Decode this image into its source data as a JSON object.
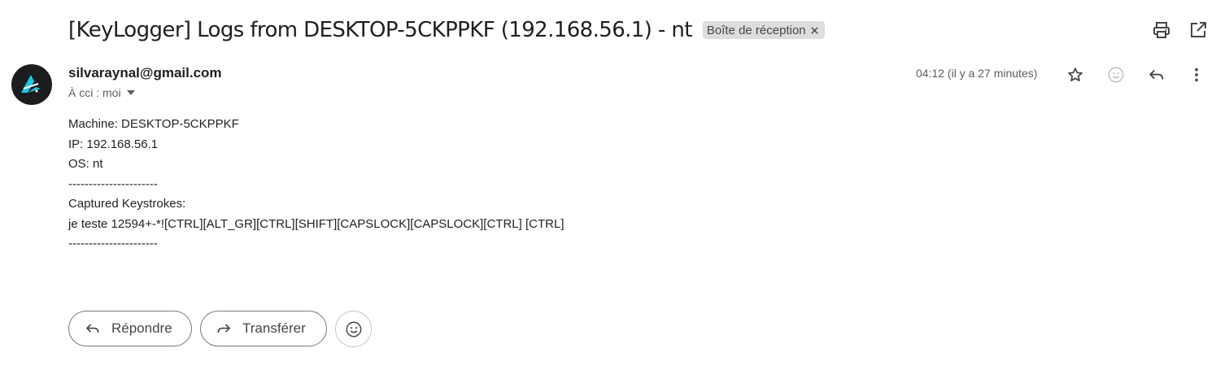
{
  "subject": {
    "title": "[KeyLogger] Logs from DESKTOP-5CKPPKF (192.168.56.1) - nt",
    "label": "Boîte de réception",
    "label_close": "×"
  },
  "toolbar": {
    "print_icon": "print-icon",
    "open_new_window_icon": "open-in-new-icon"
  },
  "message": {
    "sender_email": "silvaraynal@gmail.com",
    "recipients": "À cci : moi",
    "timestamp": "04:12 (il y a 27 minutes)",
    "icons": [
      "star-icon",
      "emoji-icon",
      "reply-icon",
      "more-vert-icon"
    ],
    "body_lines": [
      "Machine: DESKTOP-5CKPPKF",
      "IP: 192.168.56.1",
      "OS: nt",
      "----------------------",
      "Captured Keystrokes:",
      "je teste 12594+-*![CTRL][ALT_GR][CTRL][SHIFT][CAPSLOCK][CAPSLOCK][CTRL] [CTRL]",
      "----------------------"
    ]
  },
  "actions": {
    "reply_label": "Répondre",
    "forward_label": "Transférer"
  },
  "colors": {
    "chip_bg": "#dddddd",
    "avatar_bg": "#1c1d1f",
    "avatar_accent": "#1ec8e0",
    "text_secondary": "#5e5e5e"
  }
}
